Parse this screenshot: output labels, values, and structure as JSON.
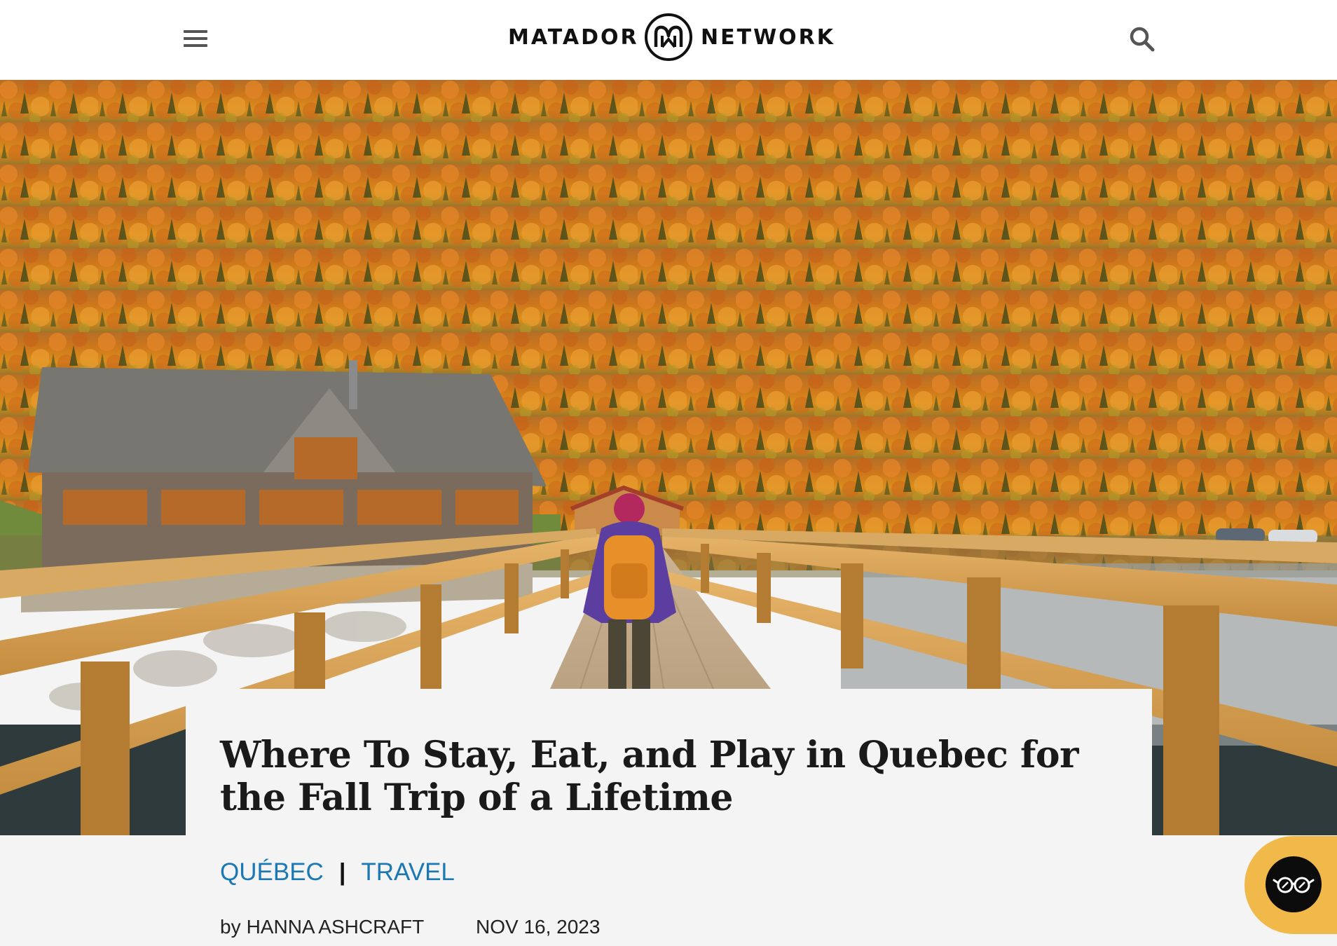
{
  "header": {
    "menu_icon": "hamburger-menu-icon",
    "logo_left": "MATADOR",
    "logo_right": "NETWORK",
    "search_icon": "search-icon"
  },
  "hero": {
    "image": "autumn forest hillside with wooden lodge and hiker on wooden bridge",
    "colors": {
      "foliage": "#e08a1f",
      "wood": "#d9a55c",
      "sky": "#b98a46"
    }
  },
  "article": {
    "title": "Where To Stay, Eat, and Play in Quebec for the Fall Trip of a Lifetime",
    "categories": [
      "QUÉBEC",
      "TRAVEL"
    ],
    "category_separator": "|",
    "byline_prefix": "by",
    "author": "HANNA ASHCRAFT",
    "date": "NOV 16, 2023"
  },
  "widget": {
    "icon": "glasses-icon",
    "colors": {
      "background": "#f1b94a",
      "button": "#0c0c0c"
    }
  },
  "colors": {
    "accent": "#1a78b4",
    "page_bg": "#f4f4f4"
  }
}
